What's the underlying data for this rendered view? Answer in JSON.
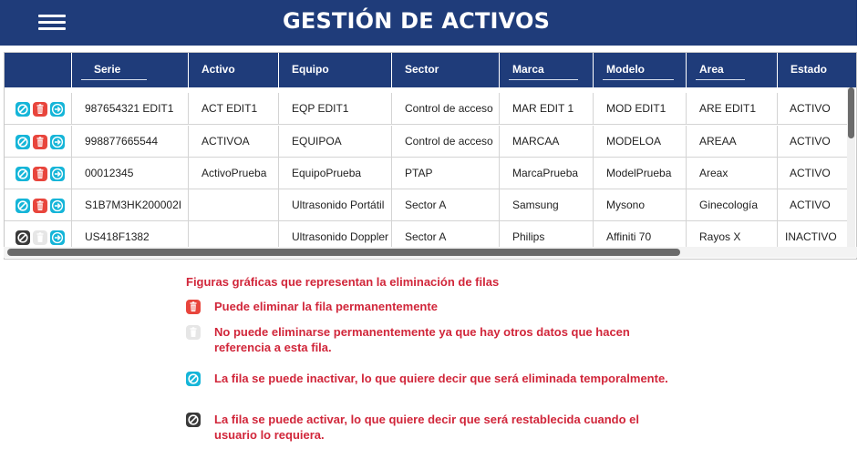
{
  "header": {
    "title": "GESTIÓN DE ACTIVOS"
  },
  "table": {
    "columns": [
      "",
      "Serie",
      "Activo",
      "Equipo",
      "Sector",
      "Marca",
      "Modelo",
      "Area",
      "Estado"
    ],
    "rows": [
      {
        "actions": [
          "inactivate",
          "delete",
          "go"
        ],
        "delete_enabled": true,
        "cells": [
          "987654321 EDIT1",
          "ACT EDIT1",
          "EQP EDIT1",
          "Control de acceso",
          "MAR EDIT 1",
          "MOD EDIT1",
          "ARE EDIT1",
          "ACTIVO"
        ]
      },
      {
        "actions": [
          "inactivate",
          "delete",
          "go"
        ],
        "delete_enabled": true,
        "cells": [
          "998877665544",
          "ACTIVOA",
          "EQUIPOA",
          "Control de acceso",
          "MARCAA",
          "MODELOA",
          "AREAA",
          "ACTIVO"
        ]
      },
      {
        "actions": [
          "inactivate",
          "delete",
          "go"
        ],
        "delete_enabled": true,
        "cells": [
          "00012345",
          "ActivoPrueba",
          "EquipoPrueba",
          "PTAP",
          "MarcaPrueba",
          "ModelPrueba",
          "Areax",
          "ACTIVO"
        ]
      },
      {
        "actions": [
          "inactivate",
          "delete",
          "go"
        ],
        "delete_enabled": true,
        "cells": [
          "S1B7M3HK200002I",
          "",
          "Ultrasonido Portátil",
          "Sector A",
          "Samsung",
          "Mysono",
          "Ginecología",
          "ACTIVO"
        ]
      },
      {
        "actions": [
          "activate",
          "delete-disabled",
          "go"
        ],
        "delete_enabled": false,
        "cells": [
          "US418F1382",
          "",
          "Ultrasonido Doppler",
          "Sector A",
          "Philips",
          "Affiniti 70",
          "Rayos X",
          "INACTIVO"
        ]
      }
    ]
  },
  "legend": {
    "title": "Figuras gráficas que representan la eliminación de filas",
    "items": [
      {
        "icon": "delete-icon",
        "text": "Puede eliminar  la  fila  permanentemente"
      },
      {
        "icon": "delete-disabled-icon",
        "text": "No puede eliminarse permanentemente ya que hay otros datos que hacen referencia a esta fila."
      },
      {
        "icon": "inactivate-icon",
        "text": "La  fila   se puede inactivar, lo que quiere decir que será eliminada temporalmente."
      },
      {
        "icon": "activate-icon",
        "text": "La  fila   se puede activar, lo que quiere decir que será restablecida cuando el usuario lo requiera."
      }
    ]
  },
  "colors": {
    "header_bg": "#1f3c7a",
    "cyan": "#15b5d8",
    "red": "#e8453c",
    "dark": "#3a3a3a",
    "legend_text": "#d1263a"
  }
}
